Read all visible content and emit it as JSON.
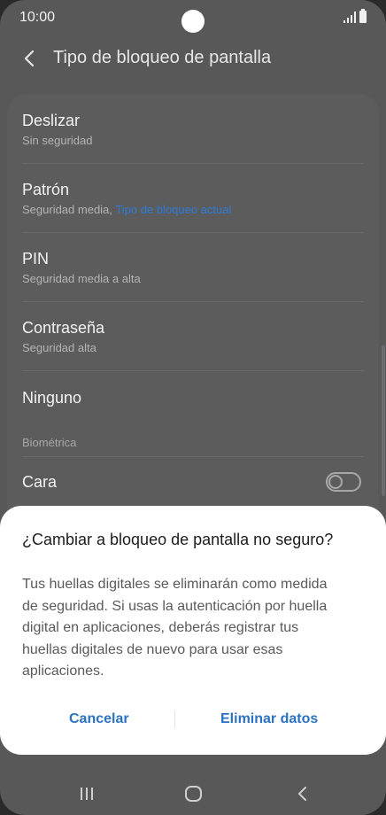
{
  "status_bar": {
    "time": "10:00",
    "signal_icon": "signal-bars-icon",
    "battery_icon": "battery-icon"
  },
  "header": {
    "back_icon": "chevron-left-icon",
    "title": "Tipo de bloqueo de pantalla"
  },
  "options": [
    {
      "title": "Deslizar",
      "subtitle": "Sin seguridad"
    },
    {
      "title": "Patrón",
      "subtitle": "Seguridad media,",
      "subtitle_accent": "Tipo de bloqueo actual"
    },
    {
      "title": "PIN",
      "subtitle": "Seguridad media a alta"
    },
    {
      "title": "Contraseña",
      "subtitle": "Seguridad alta"
    },
    {
      "title": "Ninguno"
    }
  ],
  "biometrics": {
    "section_label": "Biométrica",
    "face": {
      "title": "Cara",
      "enabled": false
    }
  },
  "dialog": {
    "title": "¿Cambiar a bloqueo de pantalla no seguro?",
    "body": "Tus huellas digitales se eliminarán como medida\nde seguridad. Si usas la autenticación por huella\ndigital en aplicaciones, deberás registrar tus\nhuellas digitales de nuevo para usar esas\naplicaciones.",
    "cancel_label": "Cancelar",
    "confirm_label": "Eliminar datos"
  },
  "nav_bar": {
    "recent_icon": "recent-apps-icon",
    "home_icon": "home-icon",
    "back_icon": "back-icon"
  },
  "colors": {
    "accent": "#2b73c2",
    "background_dimmed": "#585858",
    "dialog_bg": "#ffffff"
  }
}
